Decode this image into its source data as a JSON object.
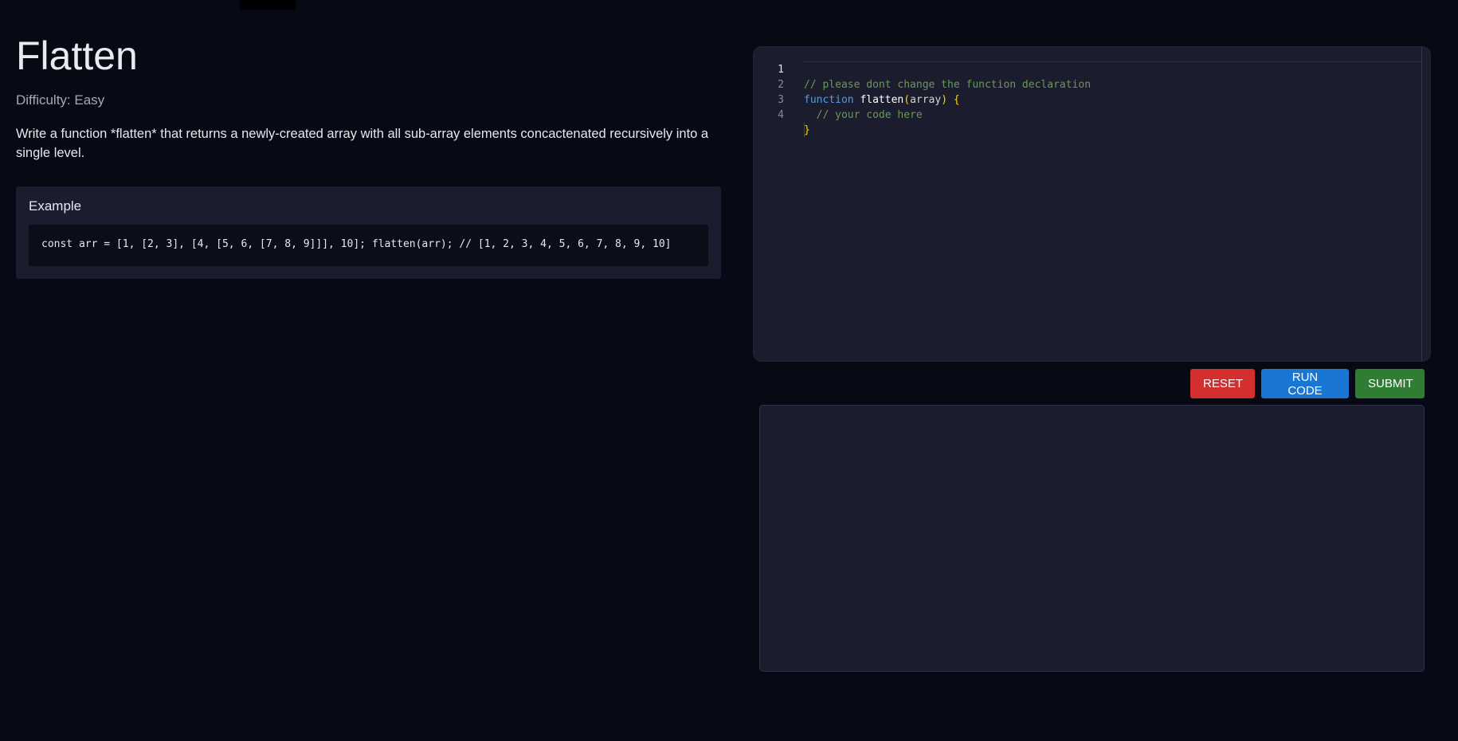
{
  "problem": {
    "title": "Flatten",
    "difficulty": "Difficulty: Easy",
    "description": "Write a function *flatten* that returns a newly-created array with all sub-array elements concactenated recursively into a single level.",
    "example_title": "Example",
    "example_code": "const arr = [1, [2, 3], [4, [5, 6, [7, 8, 9]]], 10]; flatten(arr); // [1, 2, 3, 4, 5, 6, 7, 8, 9, 10]"
  },
  "editor": {
    "line_numbers": [
      "1",
      "2",
      "3",
      "4"
    ],
    "line1_comment": "// please dont change the function declaration",
    "line2_keyword": "function",
    "line2_name": "flatten",
    "line2_open_paren": "(",
    "line2_param": "array",
    "line2_close_paren": ")",
    "line2_brace": "{",
    "line3_comment": "// your code here",
    "line4_brace": "}"
  },
  "buttons": {
    "reset": "RESET",
    "run": "RUN CODE",
    "submit": "SUBMIT"
  },
  "colors": {
    "background": "#070a14",
    "panel": "#1b1c2e",
    "reset": "#d32f2f",
    "run": "#1976d2",
    "submit": "#2e7d32"
  }
}
